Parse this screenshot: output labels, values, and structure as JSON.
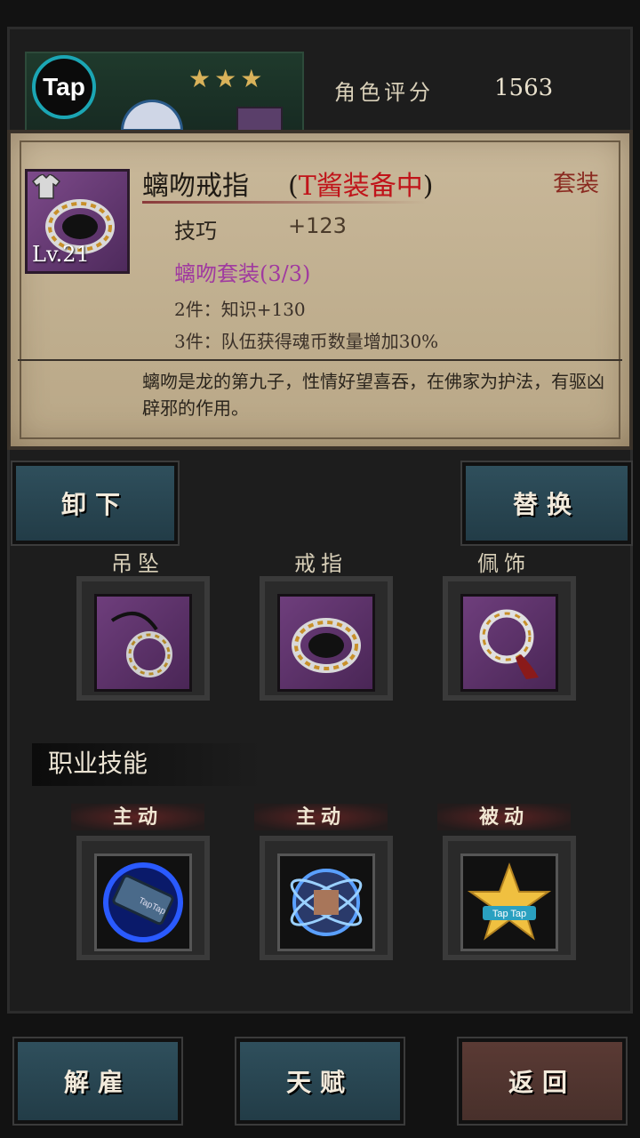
{
  "header": {
    "tap_logo_text": "Tap",
    "stars": "★★★",
    "rating_label": "角色评分",
    "rating_value": "1563"
  },
  "tooltip": {
    "item_name": "螭吻戒指",
    "open_paren": "(",
    "status": "T酱装备中",
    "close_paren": ")",
    "set_tag": "套装",
    "level": "Lv.21",
    "stat_name": "技巧",
    "stat_value": "+123",
    "set_name": "螭吻套装(3/3)",
    "set_bonus_2": "2件：知识+130",
    "set_bonus_3": "3件：队伍获得魂币数量增加30%",
    "description": "螭吻是龙的第九子，性情好望喜吞，在佛家为护法，有驱凶辟邪的作用。"
  },
  "actions": {
    "unequip": "卸下",
    "replace": "替换"
  },
  "equipment_slots": [
    {
      "label": "吊坠",
      "icon": "pendant-icon"
    },
    {
      "label": "戒指",
      "icon": "ring-icon"
    },
    {
      "label": "佩饰",
      "icon": "ornament-icon"
    }
  ],
  "skills": {
    "title": "职业技能",
    "items": [
      {
        "tag": "主动",
        "icon": "scroll-skill-icon",
        "icon_text": "TapTap"
      },
      {
        "tag": "主动",
        "icon": "orbit-skill-icon"
      },
      {
        "tag": "被动",
        "icon": "star-skill-icon",
        "icon_text": "Tap Tap"
      }
    ]
  },
  "bottom_buttons": {
    "dismiss": "解雇",
    "talent": "天赋",
    "back": "返回"
  },
  "colors": {
    "status_red": "#c0141a",
    "set_purple": "#a03aa0",
    "slot_purple": "#6e3e7c",
    "button_teal": "#2f4f5c"
  }
}
